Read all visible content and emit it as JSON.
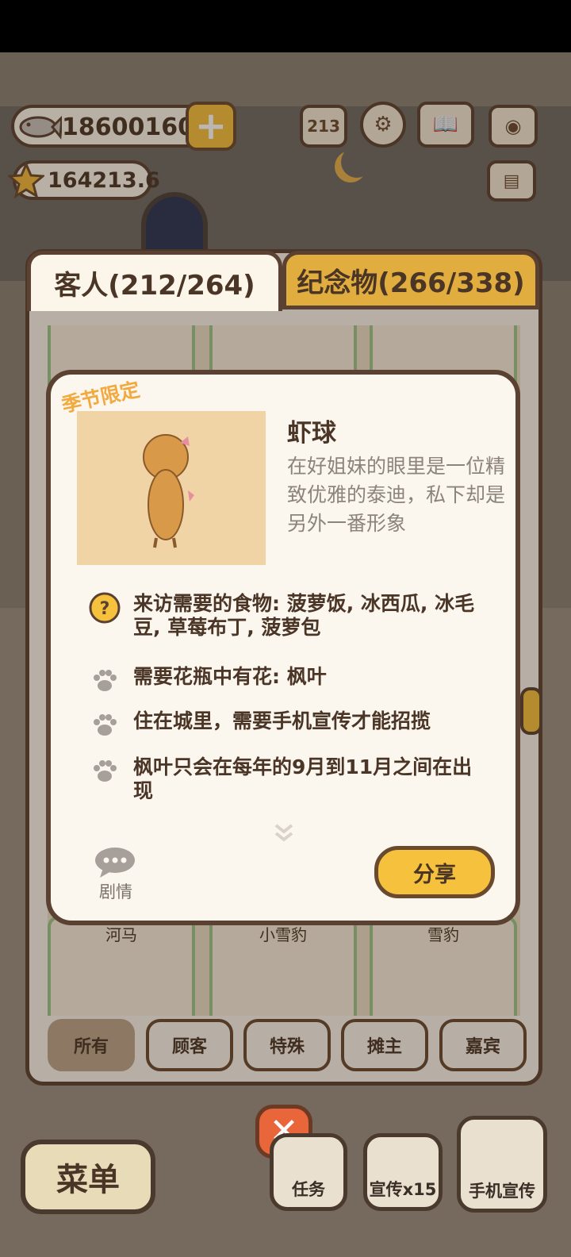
{
  "hud": {
    "fish_count": "18600160",
    "star_count": "164213.6"
  },
  "tabs": {
    "customers": "客人(212/264)",
    "souvenirs": "纪念物(266/338)"
  },
  "cards": [
    {
      "name": "河马"
    },
    {
      "name": "小雪豹"
    },
    {
      "name": "雪豹"
    }
  ],
  "filters": [
    "所有",
    "顾客",
    "特殊",
    "摊主",
    "嘉宾"
  ],
  "detail": {
    "badge": "季节限定",
    "name": "虾球",
    "description": "在好姐妹的眼里是一位精致优雅的泰迪，私下却是另外一番形象",
    "requirements": [
      {
        "icon": "question-icon",
        "text": "来访需要的食物: 菠萝饭, 冰西瓜, 冰毛豆, 草莓布丁, 菠萝包"
      },
      {
        "icon": "paw-icon",
        "text": "需要花瓶中有花: 枫叶"
      },
      {
        "icon": "paw-icon",
        "text": "住在城里，需要手机宣传才能招揽"
      },
      {
        "icon": "paw-icon",
        "text": "枫叶只会在每年的9月到11月之间在出现"
      }
    ],
    "story_label": "剧情",
    "share_label": "分享"
  },
  "bottom": {
    "menu": "菜单",
    "tasks": "任务",
    "promo": "宣传x15",
    "phone_promo": "手机宣传"
  },
  "colors": {
    "accent_yellow": "#f6c23d",
    "tab_gold": "#e0ad3e",
    "outline_brown": "#5a4132",
    "close_red": "#e9653a",
    "badge_orange": "#f2a940"
  }
}
